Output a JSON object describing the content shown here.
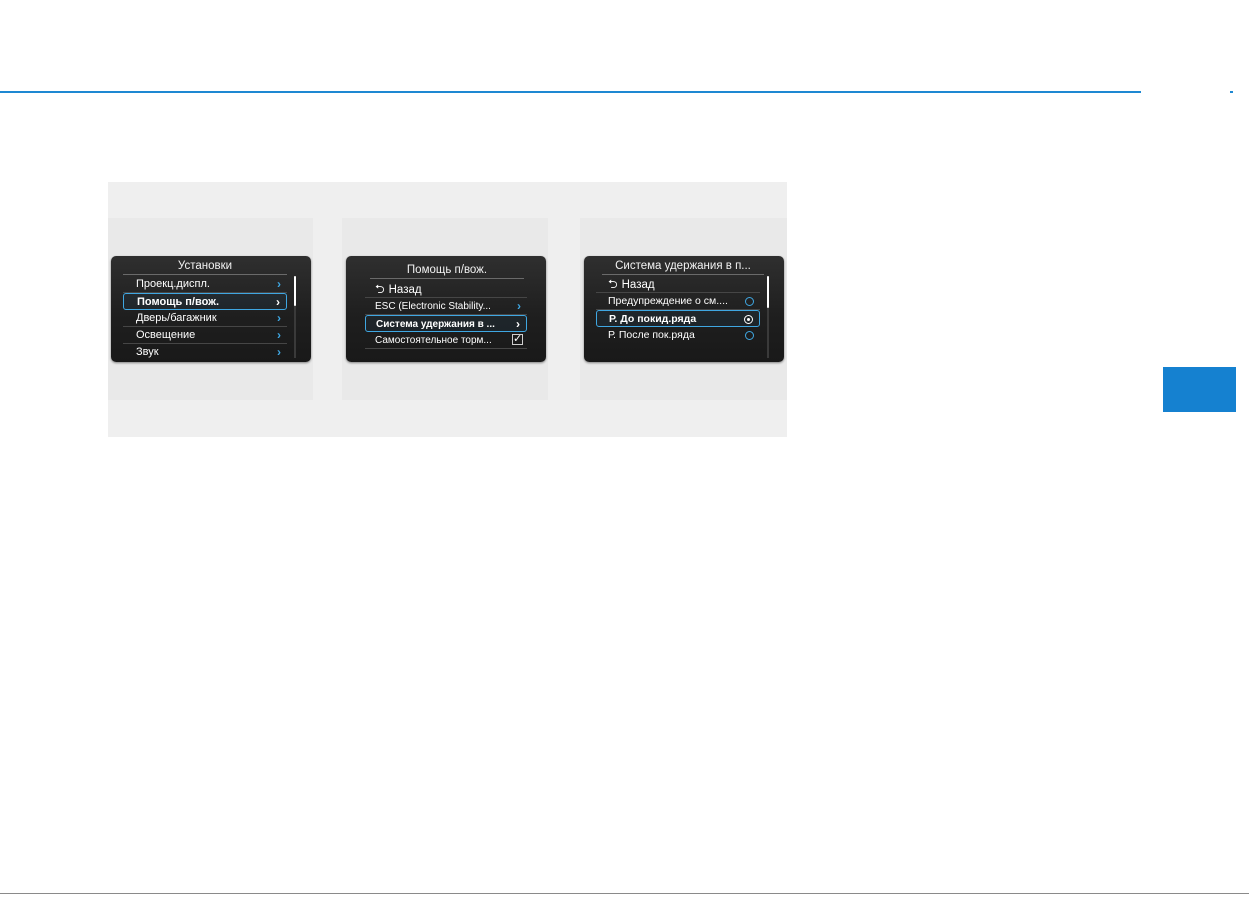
{
  "page": {
    "accent_color": "#1e88d2",
    "tab_color": "#1581d0"
  },
  "screens": [
    {
      "title": "Установки",
      "items": [
        {
          "label": "Проекц.диспл.",
          "icon": "chevron-right-icon"
        },
        {
          "label": "Помощь п/вож.",
          "icon": "chevron-right-icon",
          "selected": true
        },
        {
          "label": "Дверь/багажник",
          "icon": "chevron-right-icon"
        },
        {
          "label": "Освещение",
          "icon": "chevron-right-icon"
        },
        {
          "label": "Звук",
          "icon": "chevron-right-icon"
        }
      ]
    },
    {
      "title": "Помощь п/вож.",
      "back_label": "Назад",
      "items": [
        {
          "label": "ESC (Electronic Stability...",
          "icon": "chevron-right-icon"
        },
        {
          "label": "Система удержания в ...",
          "icon": "chevron-right-icon",
          "selected": true
        },
        {
          "label": "Самостоятельное торм...",
          "icon": "checkbox-checked-icon",
          "checked": true
        }
      ]
    },
    {
      "title": "Система удержания в п...",
      "back_label": "Назад",
      "items": [
        {
          "label": "Предупреждение о см....",
          "icon": "radio-icon",
          "selected_radio": false
        },
        {
          "label": "Р. До покид.ряда",
          "icon": "radio-icon",
          "selected_radio": true,
          "selected": true
        },
        {
          "label": "Р. После пок.ряда",
          "icon": "radio-icon",
          "selected_radio": false
        }
      ]
    }
  ]
}
